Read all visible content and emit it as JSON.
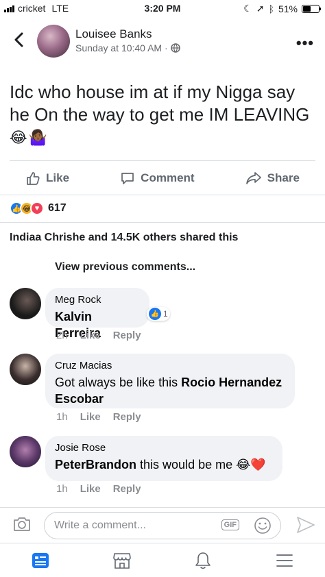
{
  "status_bar": {
    "carrier": "cricket",
    "network": "LTE",
    "time": "3:20 PM",
    "battery": "51%",
    "battery_level": 0.51
  },
  "post": {
    "author": "Louisee Banks",
    "time": "Sunday at 10:40 AM ·",
    "text": "Idc who house im at if my Nigga say he On the way to get me IM LEAVING",
    "emojis": [
      "😂",
      "🤷🏾‍♀️"
    ],
    "actions": {
      "like": "Like",
      "comment": "Comment",
      "share": "Share"
    },
    "reaction_count": "617",
    "shares_text": "Indiaa Chrishe and 14.5K others shared this"
  },
  "comments_section": {
    "view_previous": "View previous comments...",
    "comments": [
      {
        "name": "Meg Rock",
        "text": "",
        "mention": "Kalvin Ferreira",
        "mention_suffix": "",
        "reaction_count": "1",
        "age": "2h",
        "like": "Like",
        "reply": "Reply"
      },
      {
        "name": "Cruz Macias",
        "text": "Got always be like this ",
        "mention": "Rocio Hernandez Escobar",
        "mention_suffix": "",
        "age": "1h",
        "like": "Like",
        "reply": "Reply"
      },
      {
        "name": "Josie Rose",
        "text": "",
        "mention": "PeterBrandon",
        "mention_suffix": " this would be me 😂❤️",
        "age": "1h",
        "like": "Like",
        "reply": "Reply"
      }
    ]
  },
  "composer": {
    "placeholder": "Write a comment...",
    "gif": "GIF"
  },
  "colors": {
    "accent": "#1877f2",
    "text_secondary": "#65676b",
    "bubble_bg": "#f0f2f5",
    "love": "#f33e58",
    "haha": "#f7b125"
  },
  "icons": {
    "tabs": [
      "news-feed-icon",
      "marketplace-icon",
      "notifications-icon",
      "menu-icon"
    ]
  }
}
